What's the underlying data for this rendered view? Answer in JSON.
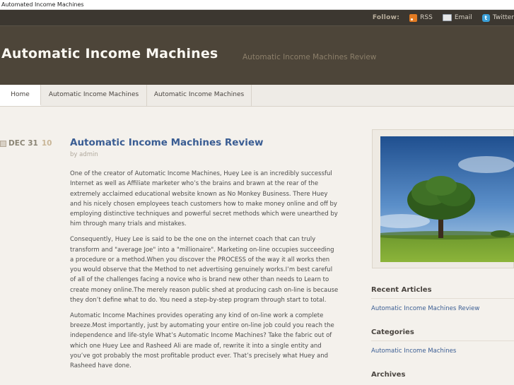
{
  "window_title": "Automated Income Machines",
  "follow": {
    "label": "Follow:",
    "items": [
      {
        "icon": "rss-icon",
        "label": "RSS"
      },
      {
        "icon": "email-icon",
        "label": "Email"
      },
      {
        "icon": "twitter-icon",
        "label": "Twitter"
      }
    ]
  },
  "header": {
    "site_title": "Automatic Income Machines",
    "site_description": "Automatic Income Machines Review"
  },
  "nav": [
    {
      "label": "Home"
    },
    {
      "label": "Automatic Income Machines"
    },
    {
      "label": "Automatic Income Machines"
    }
  ],
  "post": {
    "date_month_day": "DEC 31",
    "date_year": "10",
    "title": "Automatic Income Machines Review",
    "byline_prefix": "by",
    "author": "admin",
    "paragraphs": [
      "One of the creator of Automatic Income Machines, Huey Lee is an incredibly successful Internet as well as Affiliate marketer who’s the brains and brawn at the rear of the extremely acclaimed educational website known as No Monkey Business. There Huey and his nicely chosen employees teach customers how to make money online and off by employing distinctive techniques and powerful secret methods which were unearthed by him through many trials and mistakes.",
      "Consequently, Huey Lee is said to be the one on the internet coach that can truly transform and \"average Joe\" into a \"millionaire\". Marketing on-line occupies succeeding a procedure or a method.When you discover the PROCESS of the way it all works then you would observe that the Method to net advertising genuinely works.I’m best careful of all of the challenges facing a novice who is brand new other than needs to Learn to create money online.The merely reason public shed at producing cash on-line is because they don’t define what to do. You need a step-by-step program through start to total.",
      "Automatic Income Machines provides operating any kind of on-line work a complete breeze.Most importantly, just by automating your entire on-line job could you reach the independence and life-style What’s Automatic Income Machines? Take the fabric out of which one Huey Lee and Rasheed Ali are made of, rewrite it into a single entity and you’ve got probably the most profitable product ever. That’s precisely what Huey and Rasheed have done."
    ]
  },
  "sidebar": {
    "recent_heading": "Recent Articles",
    "recent_links": [
      "Automatic Income Machines Review"
    ],
    "categories_heading": "Categories",
    "categories_links": [
      "Automatic Income Machines"
    ],
    "archives_heading": "Archives"
  },
  "colors": {
    "header_bg": "#4d4539",
    "topbar_bg": "#3c3730",
    "link": "#3a5d93",
    "page_bg": "#f4f1ec"
  }
}
